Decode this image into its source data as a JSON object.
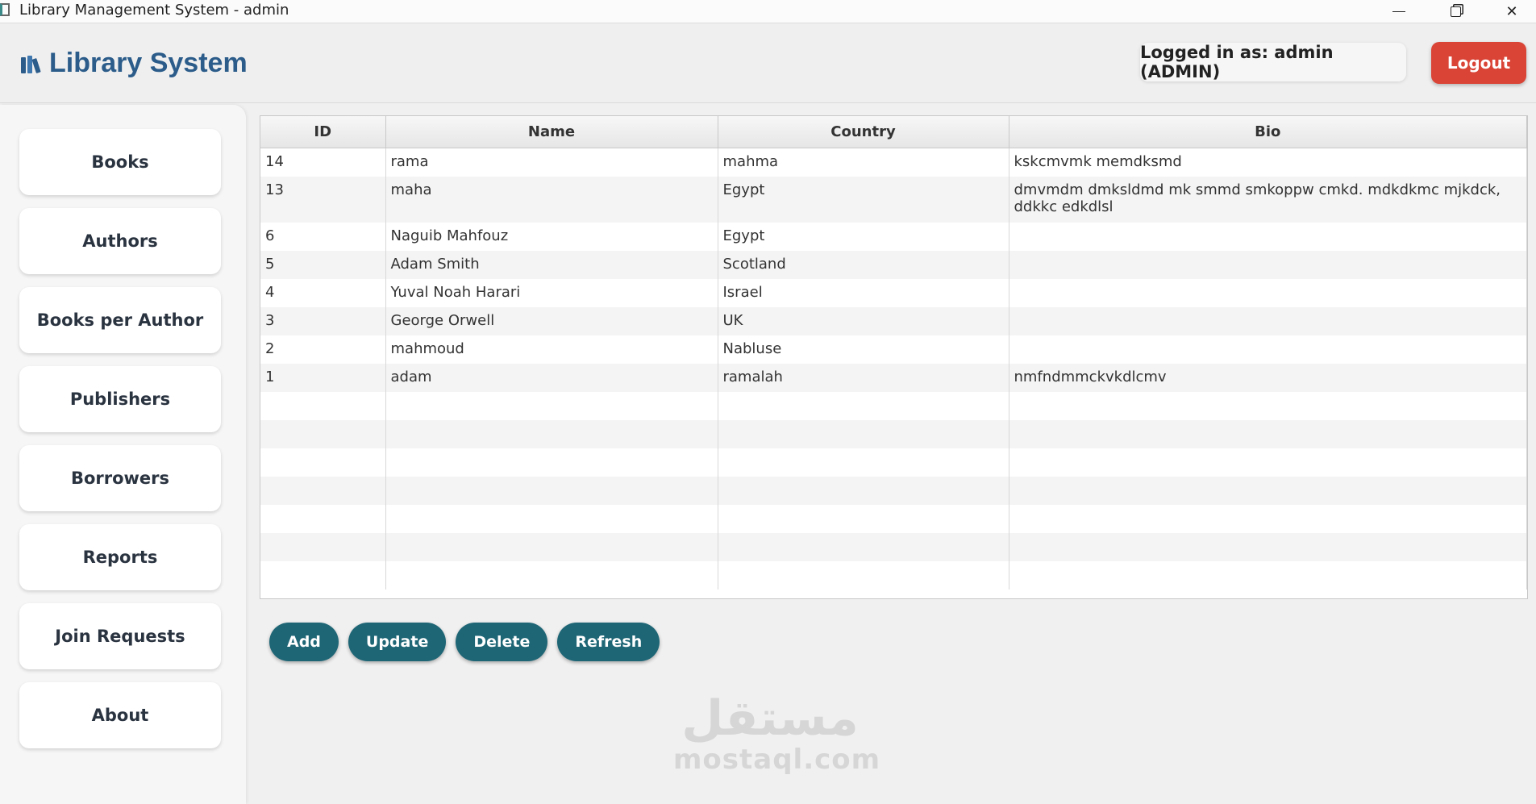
{
  "window": {
    "title": "Library Management System - admin"
  },
  "header": {
    "brand": "Library System",
    "user_badge": "Logged in as: admin (ADMIN)",
    "logout_label": "Logout",
    "colors": {
      "brand": "#2b5c8a",
      "logout": "#d94436"
    }
  },
  "sidebar": {
    "items": [
      {
        "label": "Books"
      },
      {
        "label": "Authors"
      },
      {
        "label": "Books per Author"
      },
      {
        "label": "Publishers"
      },
      {
        "label": "Borrowers"
      },
      {
        "label": "Reports"
      },
      {
        "label": "Join Requests"
      },
      {
        "label": "About"
      }
    ]
  },
  "table": {
    "columns": [
      "ID",
      "Name",
      "Country",
      "Bio"
    ],
    "rows": [
      {
        "id": "14",
        "name": "rama",
        "country": "mahma",
        "bio": "kskcmvmk memdksmd"
      },
      {
        "id": "13",
        "name": "maha",
        "country": "Egypt",
        "bio": "dmvmdm dmksldmd mk smmd smkoppw cmkd. mdkdkmc mjkdck, ddkkc edkdlsl"
      },
      {
        "id": "6",
        "name": "Naguib Mahfouz",
        "country": "Egypt",
        "bio": ""
      },
      {
        "id": "5",
        "name": "Adam Smith",
        "country": "Scotland",
        "bio": ""
      },
      {
        "id": "4",
        "name": "Yuval Noah Harari",
        "country": "Israel",
        "bio": ""
      },
      {
        "id": "3",
        "name": "George Orwell",
        "country": "UK",
        "bio": ""
      },
      {
        "id": "2",
        "name": "mahmoud",
        "country": "Nabluse",
        "bio": ""
      },
      {
        "id": "1",
        "name": "adam",
        "country": "ramalah",
        "bio": "nmfndmmckvkdlcmv"
      }
    ]
  },
  "actions": {
    "add": "Add",
    "update": "Update",
    "delete": "Delete",
    "refresh": "Refresh",
    "color": "#1e6676"
  },
  "watermark": {
    "arabic": "مستقل",
    "latin": "mostaql.com"
  }
}
